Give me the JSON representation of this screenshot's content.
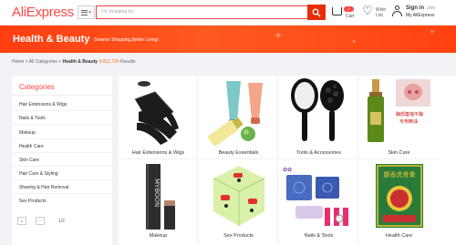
{
  "header": {
    "logo": "AliExpress",
    "search_placeholder": "I'm shopping for",
    "cart_count": "0",
    "cart_label": "Cart",
    "wish_label_1": "Wish",
    "wish_label_2": "List",
    "sign_in": "Sign in",
    "join": "Join",
    "my_aliexpress": "My AliExpress"
  },
  "banner": {
    "title": "Health & Beauty",
    "subtitle": "Smarter Shopping,Better Living!"
  },
  "breadcrumb": {
    "home": "Home",
    "sep1": " > ",
    "all_categories": "All Categories",
    "sep2": " > ",
    "current": "Health & Beauty",
    "count": "4,912,726",
    "results": " Results"
  },
  "sidebar": {
    "title": "Categories",
    "items": [
      {
        "label": "Hair Extensions & Wigs"
      },
      {
        "label": "Nails & Tools"
      },
      {
        "label": "Makeup"
      },
      {
        "label": "Health Care"
      },
      {
        "label": "Skin Care"
      },
      {
        "label": "Hair Care & Styling"
      },
      {
        "label": "Shaving & Hair Removal"
      },
      {
        "label": "Sex Products"
      }
    ],
    "pager": {
      "prev": "v",
      "next": "^",
      "page": "1/2"
    }
  },
  "tiles": [
    {
      "label": "Hair Extensions & Wigs"
    },
    {
      "label": "Beauty Essentials"
    },
    {
      "label": "Tools & Accessories"
    },
    {
      "label": "Skin Care"
    },
    {
      "label": "Makeup"
    },
    {
      "label": "Sex Products"
    },
    {
      "label": "Nails & Tools"
    },
    {
      "label": "Health Care"
    }
  ],
  "colors": {
    "brand": "#ff4747",
    "banner": "#ff4a14",
    "search_button": "#e62e04"
  }
}
